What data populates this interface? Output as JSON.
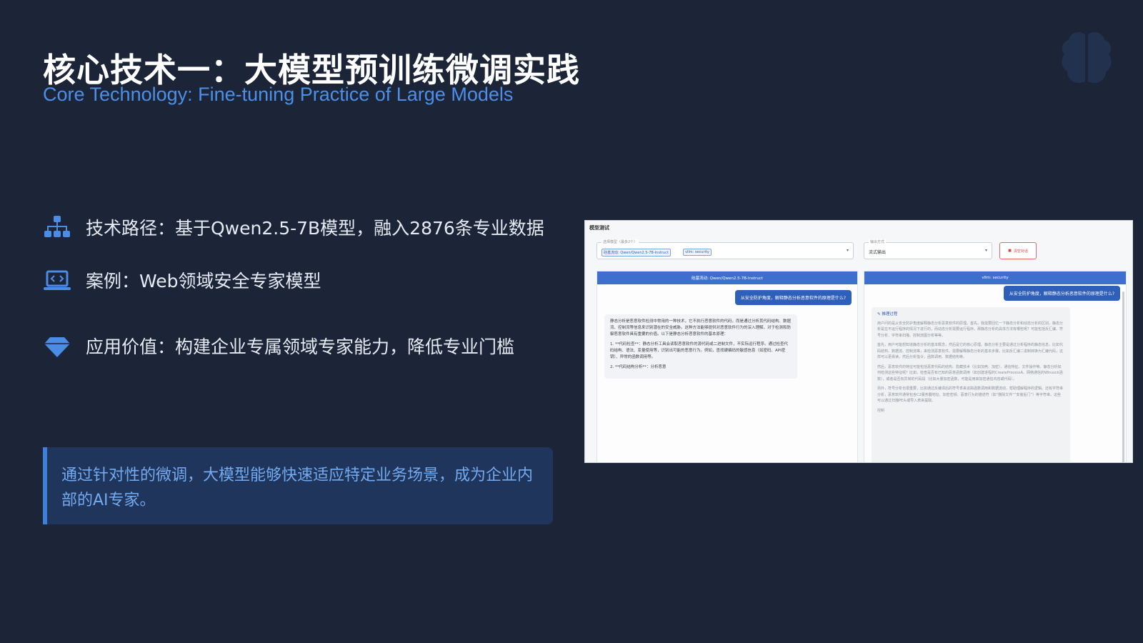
{
  "header": {
    "title": "核心技术一：大模型预训练微调实践",
    "subtitle": "Core Technology: Fine-tuning Practice of Large Models",
    "brain_icon": "brain-icon"
  },
  "features": [
    {
      "icon": "sitemap-icon",
      "text": "技术路径：基于Qwen2.5-7B模型，融入2876条专业数据"
    },
    {
      "icon": "laptop-code-icon",
      "text": "案例：Web领域安全专家模型"
    },
    {
      "icon": "diamond-icon",
      "text": "应用价值：构建企业专属领域专家能力，降低专业门槛"
    }
  ],
  "callout": {
    "text": "通过针对性的微调，大模型能够快速适应特定业务场景，成为企业内部的AI专家。"
  },
  "screenshot": {
    "title": "模型测试",
    "model_select": {
      "label": "选择模型（最多2个）",
      "chips": [
        "硅基流动: Qwen/Qwen2.5-7B-Instruct",
        "vllm: security"
      ]
    },
    "output_select": {
      "label": "输出方式",
      "value": "流式输出"
    },
    "clear_button": "清空对话",
    "left_pane": {
      "header": "硅基流动: Qwen/Qwen2.5-7B-Instruct",
      "question": "从安全防护角度，解释静态分析恶意软件的原理是什么?",
      "answer": [
        "静态分析是恶意软件检测中常用的一种技术，它不执行恶意软件的代码，而是通过分析其代码结构、数据流、控制流等信息来识别潜在的安全威胁。这种方法能够提供对恶意软件行为的深入理解，对于检测和防御恶意软件具有重要的价值。以下是静态分析恶意软件的基本原理：",
        "1. **代码检查**：静态分析工具会读取恶意软件的源代码或二进制文件，不实际运行程序。通过检查代码结构、语法、变量使用等，识别出可能的恶意行为。例如，查找硬编码的敏感信息（如密码、API密钥）、异常的函数调用等。",
        "2. **代码结构分析**：分析恶意"
      ]
    },
    "right_pane": {
      "header": "vllm: security",
      "question": "从安全防护角度，解释静态分析恶意软件的原理是什么?",
      "thinking_label": "推理过程",
      "thinking": [
        "用户问的是从安全防护角度解释静态分析恶意软件的原理。首先，我需要回忆一下静态分析和动态分析的区别。静态分析是在不运行程序的情况下进行的，而动态分析需要运行程序。那静态分析的具体方法有哪些呢？可能包括反汇编、符号分析、字符串扫描、控制流图分析等等。",
        "首先，用户可能想知道静态分析的基本概念，然后是它的核心原理。静态分析主要是通过分析程序的静态信息，比如代码结构、数据流、控制流等，来检测恶意软件。需要解释静态分析的基本步骤，比如反汇编二进制转换为汇编代码，这样可以更易读。然后分析指令，函数调用、数据结构等。",
        "然后，恶意软件的特征可能包括恶意代码的结构、隐藏技术（比如加壳、加密）、通信特征、文件操作等。静态分析如何检测这些特征呢？比如，检查是否有已知的恶意函数调用（如创建进程的CreateProcessA、网络通信的Winsock函数），或者是否有异常的代码段（比如大量加密函数，可能是用来加密通信内容或代码）。",
        "另外，符号分析也很重要，比如通过反编译后的符号表来追踪函数调用和数据流动，帮助理解程序的逻辑。还有字符串分析，恶意软件通常包含C2服务器地址、加密密钥、恶意行为的描述符（如“删除文件”“安装后门”）等字符串。这些可以通过扫描PE头或导入表来提取。",
        "控制"
      ]
    }
  }
}
